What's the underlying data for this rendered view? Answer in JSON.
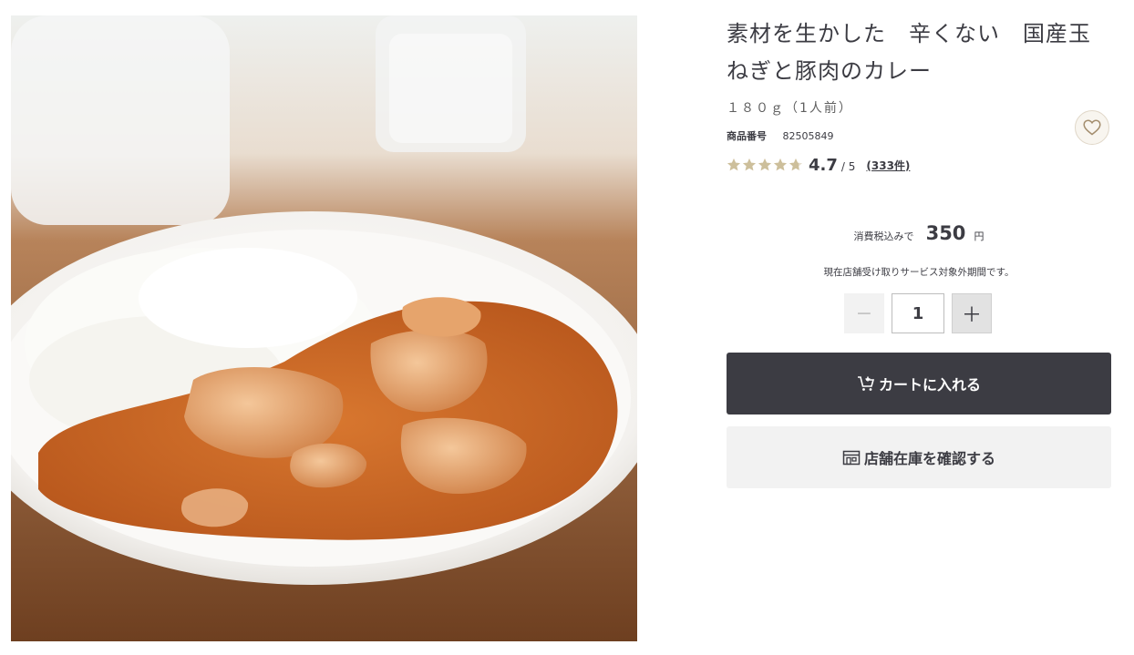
{
  "product": {
    "title": "素材を生かした　辛くない　国産玉ねぎと豚肉のカレー",
    "size": "１８０ｇ（1人前）",
    "sku_label": "商品番号",
    "sku_value": "82505849",
    "image_alt": "product-photo"
  },
  "rating": {
    "score": "4.7",
    "out_of": "/ 5",
    "reviews": "(333件)",
    "stars": 4.7,
    "star_color": "#cdbf9b"
  },
  "price": {
    "label": "消費税込みで",
    "value": "350",
    "unit": "円"
  },
  "notice": "現在店舗受け取りサービス対象外期間です。",
  "quantity": {
    "value": "1",
    "minus": "−",
    "plus": "＋"
  },
  "buttons": {
    "cart": "カートに入れる",
    "store": "店舗在庫を確認する"
  },
  "icons": {
    "favorite": "heart-icon",
    "cart": "cart-plus-icon",
    "store": "store-icon"
  },
  "colors": {
    "primary": "#3c3c43",
    "secondary_bg": "#f2f2f2",
    "favorite_bg": "#f8f5ef"
  }
}
